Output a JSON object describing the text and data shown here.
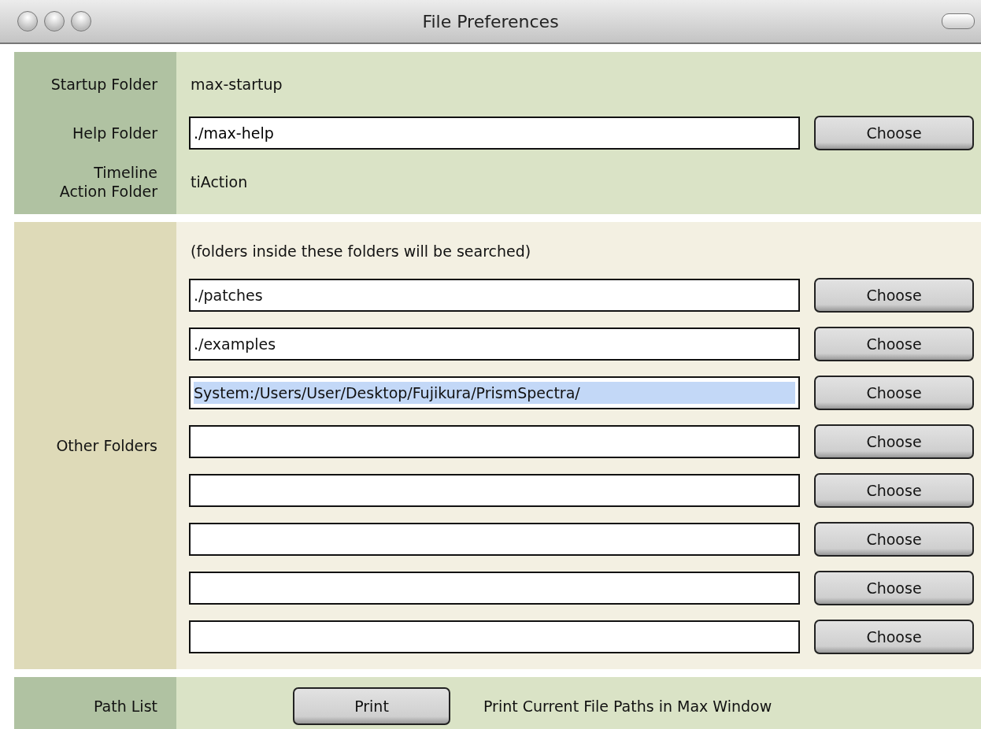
{
  "window": {
    "title": "File Preferences"
  },
  "main_folders": [
    {
      "label": "Startup Folder",
      "kind": "text",
      "value": "max-startup"
    },
    {
      "label": "Help Folder",
      "kind": "field",
      "value": "./max-help",
      "button": "Choose"
    },
    {
      "label": "Timeline\nAction Folder",
      "kind": "text",
      "value": "tiAction"
    }
  ],
  "other_folders": {
    "label": "Other Folders",
    "note": "(folders inside these folders will be searched)",
    "rows": [
      {
        "value": "./patches",
        "selected": false,
        "button": "Choose"
      },
      {
        "value": "./examples",
        "selected": false,
        "button": "Choose"
      },
      {
        "value": "System:/Users/User/Desktop/Fujikura/PrismSpectra/",
        "selected": true,
        "button": "Choose"
      },
      {
        "button": "Choose"
      },
      {
        "button": "Choose"
      },
      {
        "button": "Choose"
      },
      {
        "button": "Choose"
      },
      {
        "button": "Choose"
      }
    ]
  },
  "path_list": {
    "label": "Path List",
    "button": "Print",
    "description": "Print Current File Paths in Max Window"
  }
}
